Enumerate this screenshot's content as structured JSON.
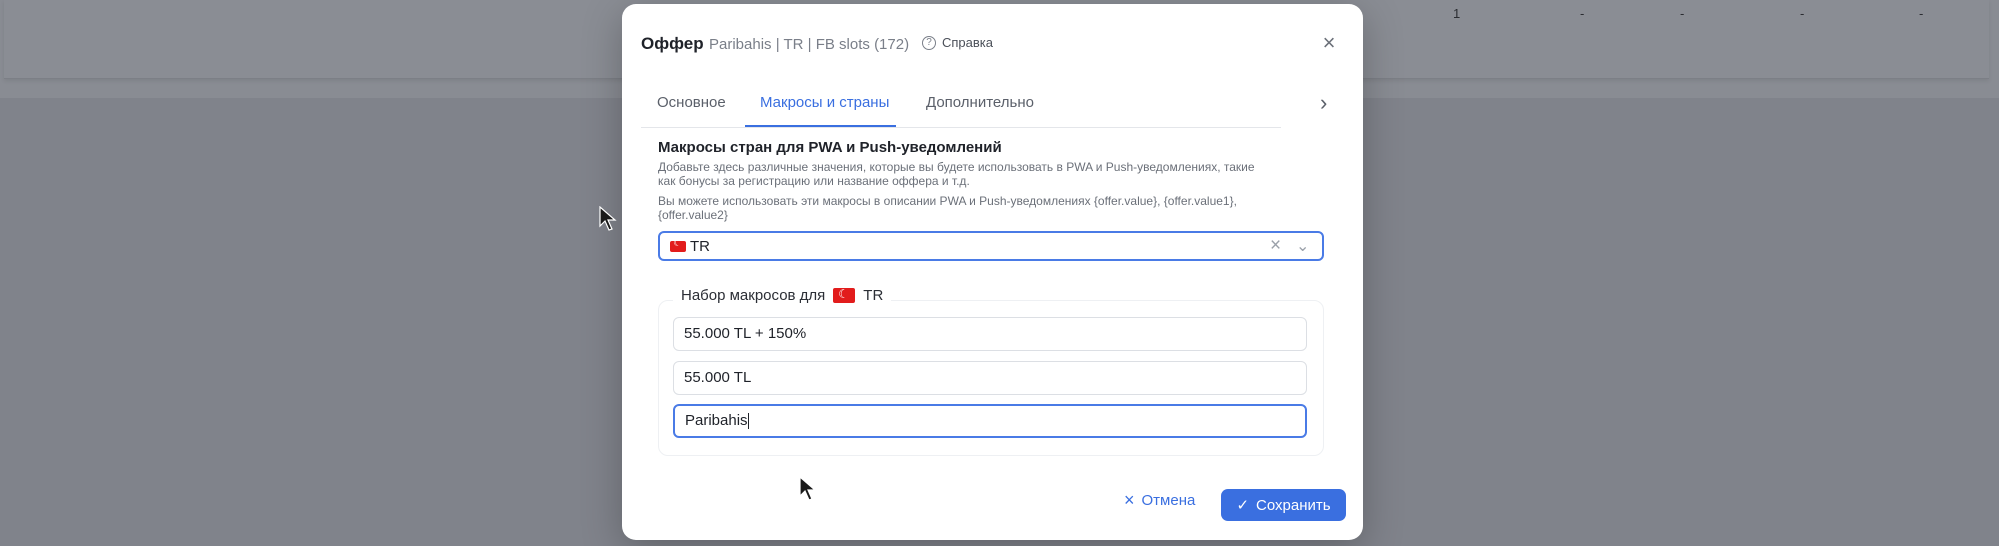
{
  "background": {
    "row_values": [
      "1",
      "-",
      "-",
      "-",
      "-"
    ]
  },
  "modal": {
    "title": "Оффер",
    "subtitle": "Paribahis | TR | FB slots (172)",
    "help_label": "Справка",
    "help_icon": "?",
    "close_icon": "×"
  },
  "tabs": [
    {
      "label": "Основное",
      "active": false
    },
    {
      "label": "Макросы и страны",
      "active": true
    },
    {
      "label": "Дополнительно",
      "active": false
    }
  ],
  "tabs_next_icon": "›",
  "section": {
    "title": "Макросы стран для PWA и Push-уведомлений",
    "desc_line1": "Добавьте здесь различные значения, которые вы будете использовать в PWA и Push-уведомлениях, такие",
    "desc_line2": "как бонусы за регистрацию или название оффера и т.д.",
    "desc_line3": "Вы можете использовать эти макросы в описании PWA и Push-уведомлениях {offer.value}, {offer.value1},",
    "desc_line4": "{offer.value2}"
  },
  "country_select": {
    "value": "TR",
    "clear_icon": "×",
    "caret_icon": "⌄"
  },
  "macro_set": {
    "legend": "Набор макросов для",
    "country": "TR",
    "values": [
      "55.000 TL + 150%",
      "55.000 TL",
      "Paribahis"
    ]
  },
  "footer": {
    "cancel_icon": "×",
    "cancel_label": "Отмена",
    "save_icon": "✓",
    "save_label": "Сохранить"
  },
  "colors": {
    "accent": "#3a6fe0",
    "flag": "#e21c1c",
    "overlay": "#80838b"
  }
}
